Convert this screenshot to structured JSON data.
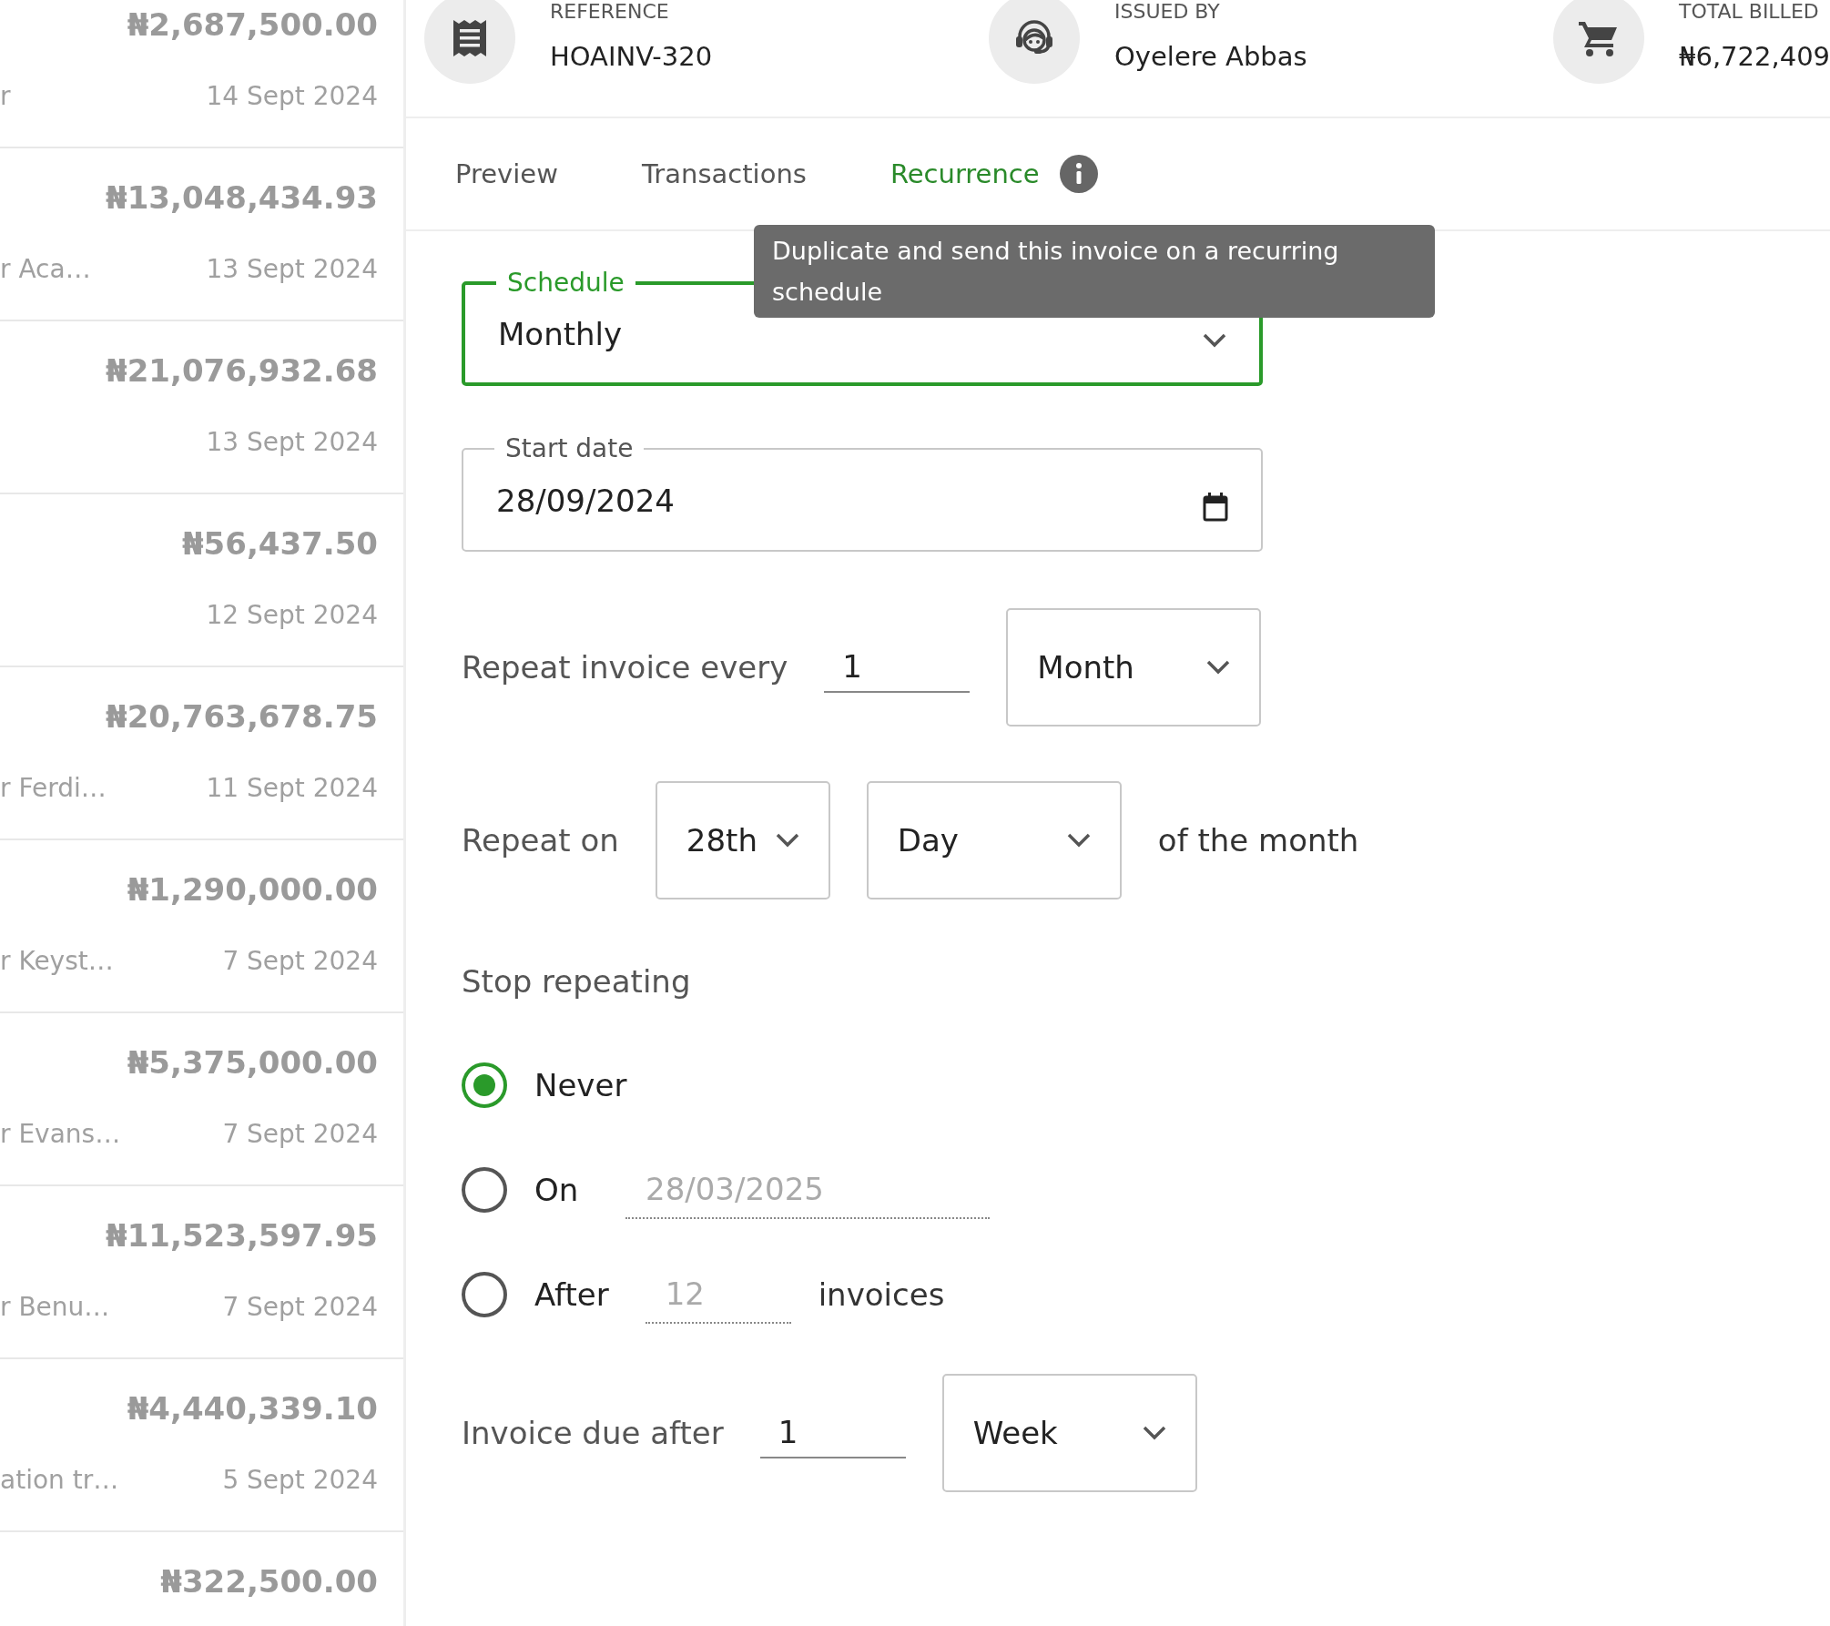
{
  "invoice_list": [
    {
      "amount": "₦2,687,500.00",
      "description": "r",
      "date": "14 Sept 2024"
    },
    {
      "amount": "₦13,048,434.93",
      "description": "r Aca…",
      "date": "13 Sept 2024"
    },
    {
      "amount": "₦21,076,932.68",
      "date": "13 Sept 2024"
    },
    {
      "amount": "₦56,437.50",
      "date": "12 Sept 2024"
    },
    {
      "amount": "₦20,763,678.75",
      "description": "r Ferdi…",
      "date": "11 Sept 2024"
    },
    {
      "amount": "₦1,290,000.00",
      "description": "r Keyst…",
      "date": "7 Sept 2024"
    },
    {
      "amount": "₦5,375,000.00",
      "description": "r Evans…",
      "date": "7 Sept 2024"
    },
    {
      "amount": "₦11,523,597.95",
      "description": "r Benu…",
      "date": "7 Sept 2024"
    },
    {
      "amount": "₦4,440,339.10",
      "description": "ation tr…",
      "date": "5 Sept 2024"
    },
    {
      "amount": "₦322,500.00"
    }
  ],
  "header": {
    "fields": [
      {
        "kind": "reference",
        "label": "REFERENCE",
        "value": "HOAINV-320"
      },
      {
        "kind": "issuer",
        "label": "ISSUED BY",
        "value": "Oyelere Abbas"
      },
      {
        "kind": "total",
        "label": "TOTAL BILLED",
        "value": "₦6,722,409"
      }
    ]
  },
  "tabs": [
    {
      "label": "Preview",
      "selected": false,
      "info": false
    },
    {
      "label": "Transactions",
      "selected": false,
      "info": false
    },
    {
      "label": "Recurrence",
      "selected": true,
      "info": true
    }
  ],
  "tooltip": {
    "text": "Duplicate and send this invoice on a recurring schedule"
  },
  "form": {
    "schedule": {
      "label": "Schedule",
      "value": "Monthly",
      "focused": true
    },
    "start_date": {
      "label": "Start date",
      "value": "28/09/2024",
      "focused": false
    },
    "repeat_every": {
      "label": "Repeat invoice every",
      "value": "1",
      "unit": "Month"
    },
    "repeat_on": {
      "label": "Repeat on",
      "day": "28th",
      "unit": "Day",
      "suffix": "of the month"
    },
    "stop_repeating": {
      "label": "Stop repeating",
      "options": [
        {
          "kind": "never",
          "label": "Never",
          "selected": true
        },
        {
          "kind": "on",
          "label": "On",
          "placeholder": "28/03/2025",
          "selected": false
        },
        {
          "kind": "after",
          "label": "After",
          "placeholder": "12",
          "suffix": "invoices",
          "selected": false
        }
      ]
    },
    "due_after": {
      "label": "Invoice due after",
      "value": "1",
      "unit": "Week"
    }
  }
}
